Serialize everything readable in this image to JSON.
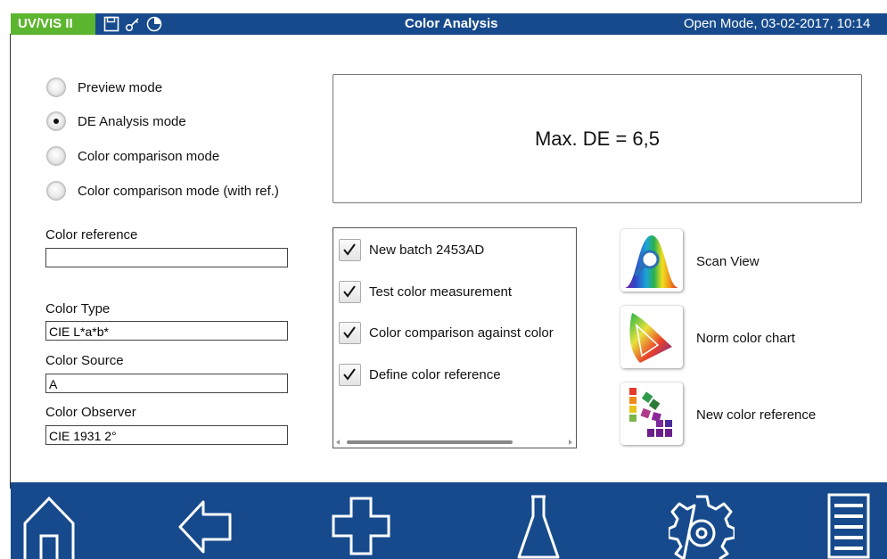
{
  "titlebar": {
    "app_name": "UV/VIS II",
    "title": "Color Analysis",
    "status": "Open Mode, 03-02-2017, 10:14",
    "icons": [
      "save-icon",
      "key-icon",
      "pie-chart-icon"
    ]
  },
  "modes": [
    {
      "label": "Preview mode",
      "checked": false
    },
    {
      "label": "DE Analysis mode",
      "checked": true
    },
    {
      "label": "Color comparison mode",
      "checked": false
    },
    {
      "label": "Color comparison mode (with ref.)",
      "checked": false
    }
  ],
  "result": {
    "text": "Max. DE = 6,5"
  },
  "fields": {
    "color_reference": {
      "label": "Color reference",
      "value": ""
    },
    "color_type": {
      "label": "Color Type",
      "value": "CIE L*a*b*"
    },
    "color_source": {
      "label": "Color Source",
      "value": "A"
    },
    "color_observer": {
      "label": "Color Observer",
      "value": "CIE 1931 2°"
    }
  },
  "checklist": [
    {
      "label": "New batch 2453AD",
      "checked": true
    },
    {
      "label": "Test color measurement",
      "checked": true
    },
    {
      "label": "Color comparison against color",
      "checked": true
    },
    {
      "label": "Define color reference",
      "checked": true
    }
  ],
  "tools": [
    {
      "label": "Scan View",
      "icon": "scan-view-icon"
    },
    {
      "label": "Norm color chart",
      "icon": "norm-color-chart-icon"
    },
    {
      "label": "New color reference",
      "icon": "color-swatches-icon"
    }
  ],
  "bottom_nav": [
    "home-icon",
    "back-arrow-icon",
    "add-icon",
    "flask-icon",
    "settings-gear-icon",
    "menu-list-icon"
  ],
  "colors": {
    "titlebar": "#164a8c",
    "app_badge": "#5cb52e",
    "bottombar": "#164a8c"
  }
}
